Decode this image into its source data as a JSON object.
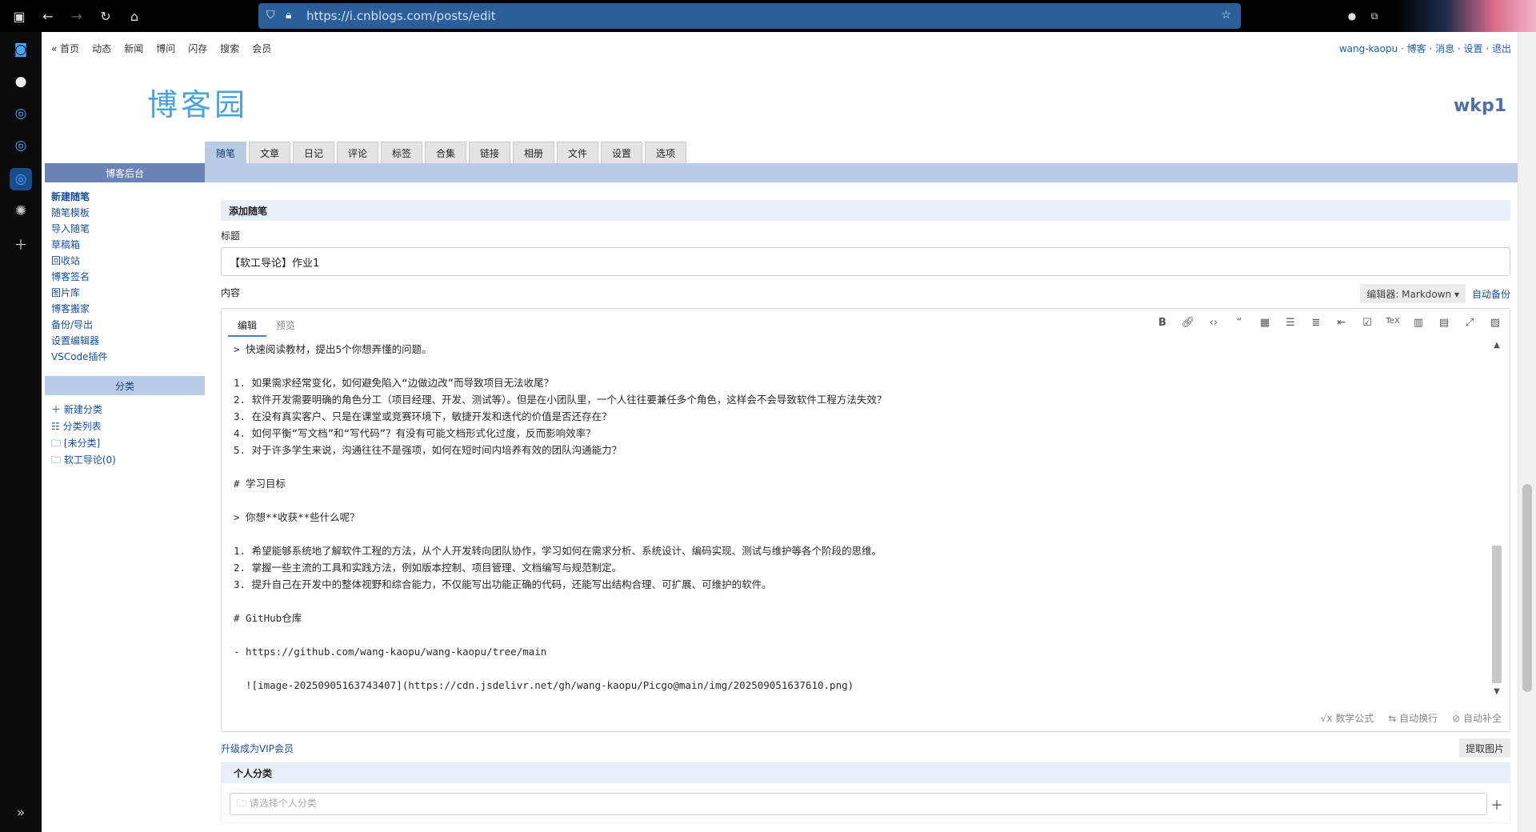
{
  "browser": {
    "url": "https://i.cnblogs.com/posts/edit"
  },
  "topnav": {
    "items": [
      "« 首页",
      "动态",
      "新闻",
      "博问",
      "闪存",
      "搜索",
      "会员"
    ],
    "user": "wang-kaopu",
    "links": "· 博客 · 消息 · 设置 · 退出"
  },
  "header": {
    "logo": "博客园",
    "site_name": "wkp1"
  },
  "tabs": [
    "随笔",
    "文章",
    "日记",
    "评论",
    "标签",
    "合集",
    "链接",
    "相册",
    "文件",
    "设置",
    "选项"
  ],
  "left_menu": {
    "title": "博客后台",
    "items": [
      "新建随笔",
      "随笔模板",
      "导入随笔",
      "草稿箱",
      "回收站",
      "博客签名",
      "图片库",
      "博客搬家",
      "备份/导出",
      "设置编辑器",
      "VSCode插件"
    ],
    "category_title": "分类",
    "categories": [
      "＋ 新建分类",
      "☷ 分类列表",
      "🗀 [未分类]",
      "🗀 软工导论(0)"
    ]
  },
  "main": {
    "section_title": "添加随笔",
    "title_label": "标题",
    "title_value": "【软工导论】作业1",
    "content_label": "内容",
    "editor_select": "编辑器: Markdown ▾",
    "auto_backup": "自动备份",
    "editor_tabs": [
      "编辑",
      "预览"
    ],
    "editor_lines": [
      "> 快速阅读教材，提出5个你想弄懂的问题。",
      "",
      "1. 如果需求经常变化，如何避免陷入“边做边改”而导致项目无法收尾？",
      "2. 软件开发需要明确的角色分工（项目经理、开发、测试等）。但是在小团队里，一个人往往要兼任多个角色，这样会不会导致软件工程方法失效？",
      "3. 在没有真实客户、只是在课堂或竞赛环境下，敏捷开发和迭代的价值是否还存在？",
      "4. 如何平衡“写文档”和“写代码”？有没有可能文档形式化过度，反而影响效率？",
      "5. 对于许多学生来说，沟通往往不是强项，如何在短时间内培养有效的团队沟通能力？",
      "",
      "# 学习目标",
      "",
      "> 你想**收获**些什么呢？",
      "",
      "1. 希望能够系统地了解软件工程的方法，从个人开发转向团队协作，学习如何在需求分析、系统设计、编码实现、测试与维护等各个阶段的思维。",
      "2. 掌握一些主流的工具和实践方法，例如版本控制、项目管理、文档编写与规范制定。",
      "3. 提升自己在开发中的整体视野和综合能力，不仅能写出功能正确的代码，还能写出结构合理、可扩展、可维护的软件。",
      "",
      "# GitHub仓库",
      "",
      "- https://github.com/wang-kaopu/wang-kaopu/tree/main",
      "",
      "  ![image-20250905163743407](https://cdn.jsdelivr.net/gh/wang-kaopu/Picgo@main/img/202509051637610.png)"
    ],
    "editor_footer": [
      "√x 数学公式",
      "⇆ 自动换行",
      "⊘ 自动补全"
    ],
    "vip_link": "升级成为VIP会员",
    "fetch_image": "提取图片",
    "personal_category": "个人分类",
    "category_placeholder": "🗀 请选择个人分类"
  }
}
